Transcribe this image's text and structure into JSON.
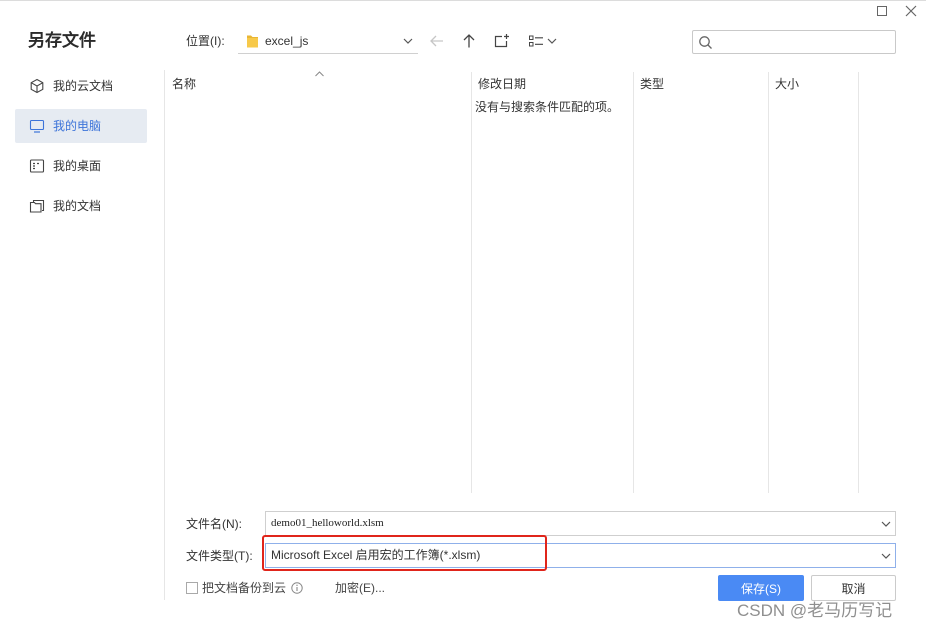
{
  "title": "另存文件",
  "window": {
    "maximize_icon": "maximize-icon",
    "close_icon": "close-icon"
  },
  "location": {
    "label": "位置(I):",
    "folder": "excel_js",
    "folder_icon": "folder-icon"
  },
  "toolbar": {
    "icons": [
      "back-arrow-icon",
      "up-arrow-icon",
      "new-folder-icon",
      "view-mode-icon"
    ]
  },
  "search": {
    "icon": "search-icon"
  },
  "sidebar": {
    "items": [
      {
        "label": "我的云文档",
        "icon": "cube-icon",
        "selected": false
      },
      {
        "label": "我的电脑",
        "icon": "monitor-icon",
        "selected": true
      },
      {
        "label": "我的桌面",
        "icon": "desktop-icon",
        "selected": false
      },
      {
        "label": "我的文档",
        "icon": "documents-icon",
        "selected": false
      }
    ]
  },
  "file_list": {
    "columns": [
      "名称",
      "修改日期",
      "类型",
      "大小"
    ],
    "sorted_column": "名称",
    "empty_message": "没有与搜索条件匹配的项。"
  },
  "form": {
    "filename_label": "文件名(N):",
    "filename_value": "demo01_helloworld.xlsm",
    "filetype_label": "文件类型(T):",
    "filetype_value": "Microsoft Excel 启用宏的工作簿(*.xlsm)"
  },
  "options": {
    "backup_label": "把文档备份到云",
    "backup_checked": false,
    "encrypt_label": "加密(E)..."
  },
  "buttons": {
    "save": "保存(S)",
    "cancel": "取消"
  },
  "watermark": "CSDN @老马历写记",
  "colors": {
    "accent": "#3d74d9",
    "selected_bg": "#e6ebf2",
    "save_button": "#4a8af4",
    "annotation": "#e0251b",
    "folder": "#f7c94a"
  }
}
